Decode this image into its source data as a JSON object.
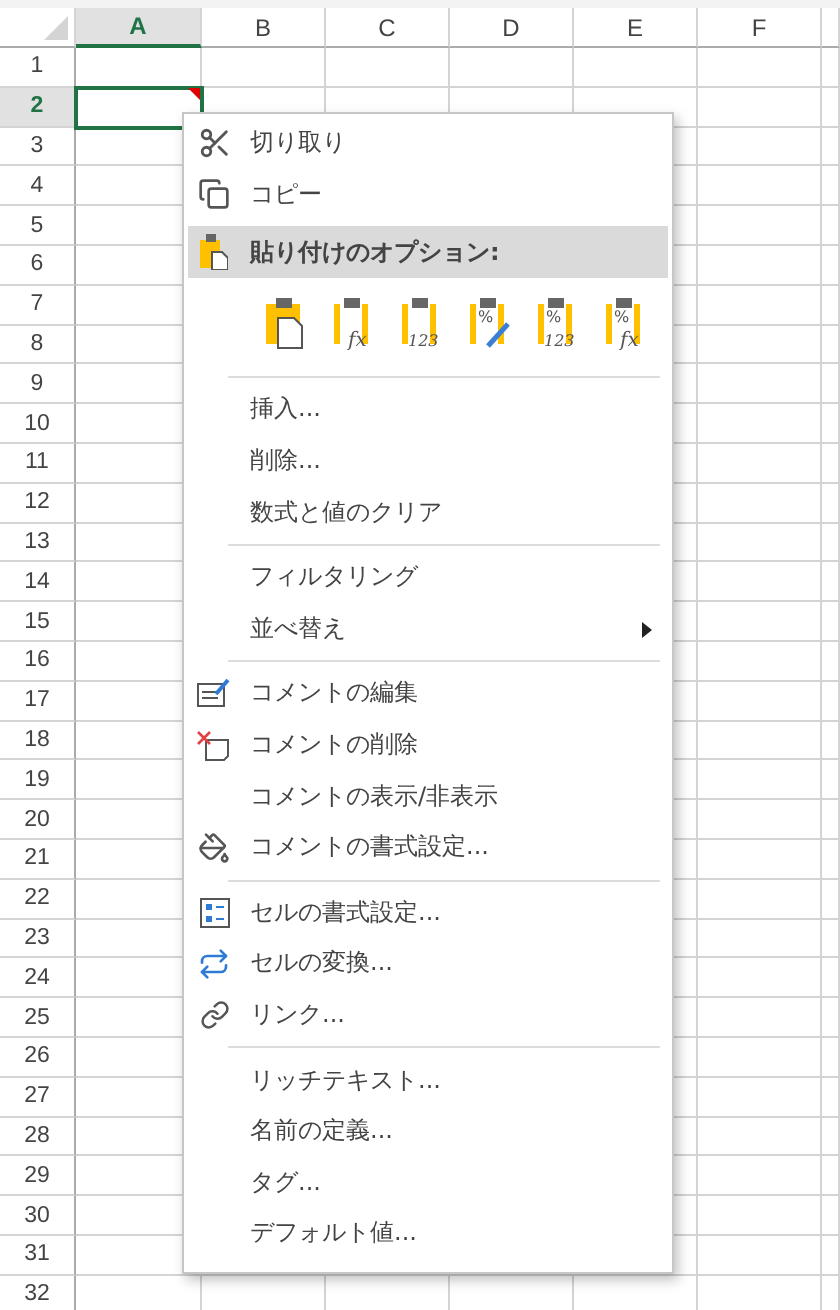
{
  "sheet": {
    "columns": [
      {
        "label": "A",
        "selected": true
      },
      {
        "label": "B",
        "selected": false
      },
      {
        "label": "C",
        "selected": false
      },
      {
        "label": "D",
        "selected": false
      },
      {
        "label": "E",
        "selected": false
      },
      {
        "label": "F",
        "selected": false
      }
    ],
    "rows": [
      {
        "label": "1",
        "selected": false
      },
      {
        "label": "2",
        "selected": true
      },
      {
        "label": "3",
        "selected": false
      },
      {
        "label": "4",
        "selected": false
      },
      {
        "label": "5",
        "selected": false
      },
      {
        "label": "6",
        "selected": false
      },
      {
        "label": "7",
        "selected": false
      },
      {
        "label": "8",
        "selected": false
      },
      {
        "label": "9",
        "selected": false
      },
      {
        "label": "10",
        "selected": false
      },
      {
        "label": "11",
        "selected": false
      },
      {
        "label": "12",
        "selected": false
      },
      {
        "label": "13",
        "selected": false
      },
      {
        "label": "14",
        "selected": false
      },
      {
        "label": "15",
        "selected": false
      },
      {
        "label": "16",
        "selected": false
      },
      {
        "label": "17",
        "selected": false
      },
      {
        "label": "18",
        "selected": false
      },
      {
        "label": "19",
        "selected": false
      },
      {
        "label": "20",
        "selected": false
      },
      {
        "label": "21",
        "selected": false
      },
      {
        "label": "22",
        "selected": false
      },
      {
        "label": "23",
        "selected": false
      },
      {
        "label": "24",
        "selected": false
      },
      {
        "label": "25",
        "selected": false
      },
      {
        "label": "26",
        "selected": false
      },
      {
        "label": "27",
        "selected": false
      },
      {
        "label": "28",
        "selected": false
      },
      {
        "label": "29",
        "selected": false
      },
      {
        "label": "30",
        "selected": false
      },
      {
        "label": "31",
        "selected": false
      },
      {
        "label": "32",
        "selected": false
      }
    ],
    "active_cell": {
      "has_comment": true
    }
  },
  "context_menu": [
    {
      "kind": "item",
      "label": "切り取り"
    },
    {
      "kind": "item",
      "label": "コピー"
    },
    {
      "kind": "header",
      "label": "貼り付けのオプション:"
    },
    {
      "kind": "paste_options",
      "options": [
        {
          "kind": "all"
        },
        {
          "kind": "formulas",
          "label": "fx"
        },
        {
          "kind": "values",
          "label": "123"
        },
        {
          "kind": "format",
          "corner": "%"
        },
        {
          "kind": "values_format",
          "corner": "%",
          "label": "123"
        },
        {
          "kind": "formulas_format",
          "corner": "%",
          "label": "fx"
        }
      ]
    },
    {
      "kind": "separator"
    },
    {
      "kind": "item",
      "label": "挿入..."
    },
    {
      "kind": "item",
      "label": "削除..."
    },
    {
      "kind": "item",
      "label": "数式と値のクリア"
    },
    {
      "kind": "separator"
    },
    {
      "kind": "item",
      "label": "フィルタリング"
    },
    {
      "kind": "item",
      "label": "並べ替え",
      "submenu": true
    },
    {
      "kind": "separator"
    },
    {
      "kind": "item",
      "label": "コメントの編集"
    },
    {
      "kind": "item",
      "label": "コメントの削除"
    },
    {
      "kind": "item",
      "label": "コメントの表示/非表示"
    },
    {
      "kind": "item",
      "label": "コメントの書式設定..."
    },
    {
      "kind": "separator"
    },
    {
      "kind": "item",
      "label": "セルの書式設定..."
    },
    {
      "kind": "item",
      "label": "セルの変換..."
    },
    {
      "kind": "item",
      "label": "リンク..."
    },
    {
      "kind": "separator"
    },
    {
      "kind": "item",
      "label": "リッチテキスト..."
    },
    {
      "kind": "item",
      "label": "名前の定義..."
    },
    {
      "kind": "item",
      "label": "タグ..."
    },
    {
      "kind": "item",
      "label": "デフォルト値..."
    }
  ]
}
